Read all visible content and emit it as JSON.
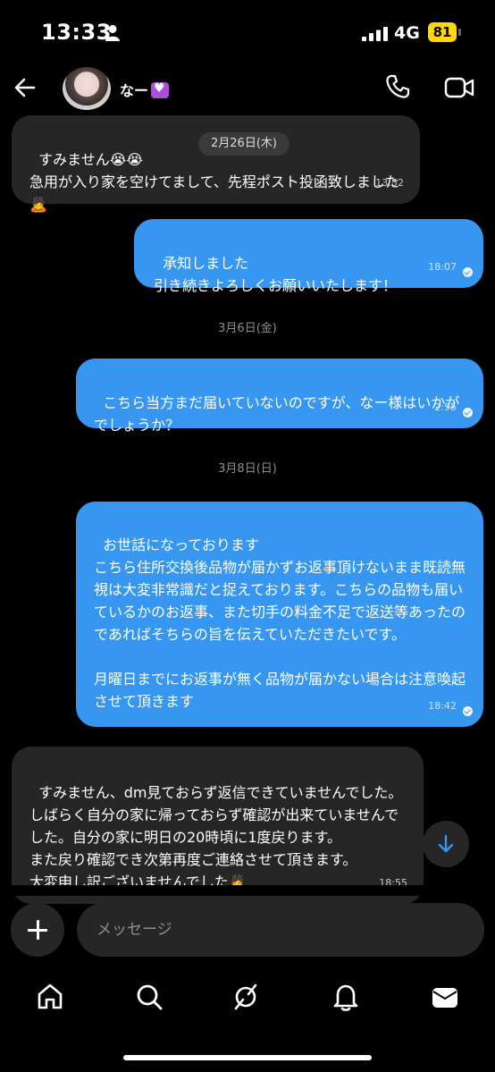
{
  "status_bar": {
    "time": "13:33",
    "network": "4G",
    "battery": "81"
  },
  "header": {
    "contact_name": "なー"
  },
  "floating_date": "2月26日(木)",
  "messages": [
    {
      "direction": "incoming",
      "text": "すみません😭😭\n急用が入り家を空けてまして、先程ポスト投函致しました🙇",
      "time": "13:52"
    },
    {
      "direction": "outgoing",
      "text": "承知しました\n引き続きよろしくお願いいたします！",
      "time": "18:07"
    },
    {
      "direction": "date",
      "text": "3月6日(金)"
    },
    {
      "direction": "outgoing",
      "text": "こちら当方まだ届いていないのですが、なー様はいかがでしょうか？",
      "time": "2:55"
    },
    {
      "direction": "date",
      "text": "3月8日(日)"
    },
    {
      "direction": "outgoing",
      "text": "お世話になっております\nこちら住所交換後品物が届かずお返事頂けないまま既読無視は大変非常識だと捉えております。こちらの品物も届いているかのお返事、また切手の料金不足で返送等あったのであればそちらの旨を伝えていただきたいです。\n\n月曜日までにお返事が無く品物が届かない場合は注意喚起させて頂きます",
      "time": "18:42"
    },
    {
      "direction": "incoming",
      "text": "すみません、dm見ておらず返信できていませんでした。\nしばらく自分の家に帰っておらず確認が出来ていませんでした。自分の家に明日の20時頃に1度戻ります。\nまた戻り確認でき次第再度ご連絡させて頂きます。\n大変申し訳ございませんでした🙇",
      "time": "18:55"
    }
  ],
  "composer": {
    "placeholder": "メッセージ"
  },
  "colors": {
    "outgoing_bubble": "#3797f0",
    "incoming_bubble": "#262626",
    "battery": "#ffd60a"
  },
  "nav_icons": [
    "home-icon",
    "search-icon",
    "explore-icon",
    "notifications-icon",
    "inbox-icon"
  ]
}
